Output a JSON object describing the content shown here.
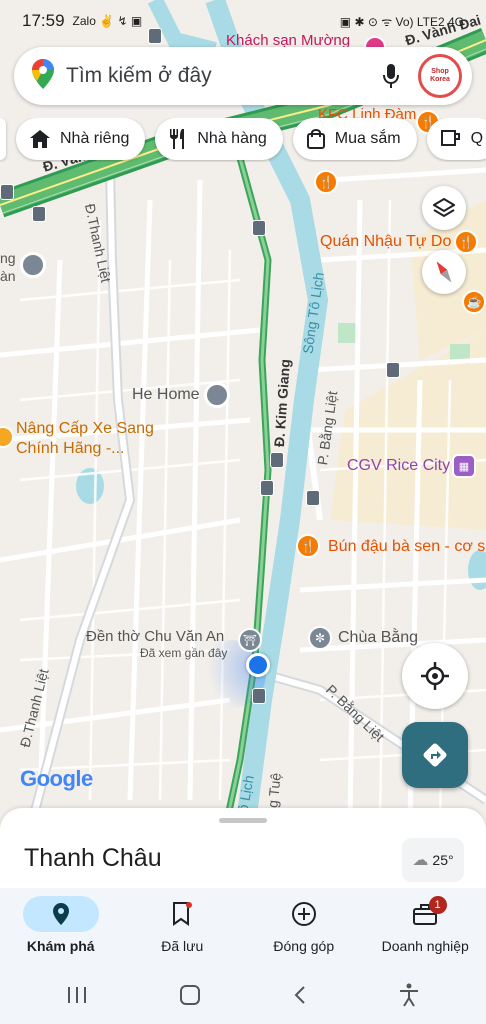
{
  "status": {
    "time": "17:59",
    "left_icons": "Zalo ✌ ↯ ▣",
    "right_icons": "▣ ✱ ⊙ ᯤ Vo) LTE2 4G"
  },
  "search": {
    "placeholder": "Tìm kiếm ở đây",
    "avatar_text": "Shop Korea"
  },
  "chips": [
    {
      "label": "Nhà riêng",
      "icon": "home-icon"
    },
    {
      "label": "Nhà hàng",
      "icon": "restaurant-icon"
    },
    {
      "label": "Mua sắm",
      "icon": "shopping-icon"
    },
    {
      "label": "Q",
      "icon": "coffee-icon"
    }
  ],
  "map_labels": {
    "hotel": "Khách sạn Mường",
    "ring_road_top": "Đ. Vành Đai",
    "ring_road_left": "Đ. Vành Đ",
    "kfc": "KFC Linh Đàm",
    "thanh_liet_top": "Đ.Thanh Liệt",
    "quan_nhau": "Quán Nhậu Tự Do",
    "song_to_lich": "Sông Tô Lịch",
    "he_home": "He Home",
    "kim_giang": "Đ. Kim Giang",
    "bang_liet_upper": "P. Bằng Liệt",
    "nang_cap_1": "Nâng Cấp Xe Sang",
    "nang_cap_2": "Chính Hãng -...",
    "cgv": "CGV Rice City",
    "bun_dau": "Bún đậu bà sen - cơ sở",
    "den_tho": "Đền thờ Chu Văn An",
    "recently_viewed": "Đã xem gần đây",
    "chua_bang": "Chùa Bằng",
    "thanh_liet_bottom": "Đ.Thanh Liệt",
    "bang_liet_lower": "P. Bằng Liệt",
    "to_lich_bottom": "Tô Lịch",
    "vong_tue": "ọng Tuệ",
    "left_edge_an": "àn",
    "left_edge_ng": "ng",
    "google": "Google"
  },
  "sheet": {
    "title": "Thanh Châu",
    "weather": "25°"
  },
  "nav": [
    {
      "label": "Khám phá",
      "icon": "explore-icon",
      "active": true
    },
    {
      "label": "Đã lưu",
      "icon": "bookmark-icon",
      "active": false
    },
    {
      "label": "Đóng góp",
      "icon": "add-circle-icon",
      "active": false
    },
    {
      "label": "Doanh nghiệp",
      "icon": "business-icon",
      "active": false,
      "badge": "1"
    }
  ],
  "colors": {
    "accent": "#0b57d0",
    "river": "#a8dbe5",
    "road_green": "#5fbb6f",
    "direction_button": "#2e6e7e",
    "poi_orange": "#f57c00",
    "poi_purple": "#9c5fc5"
  }
}
